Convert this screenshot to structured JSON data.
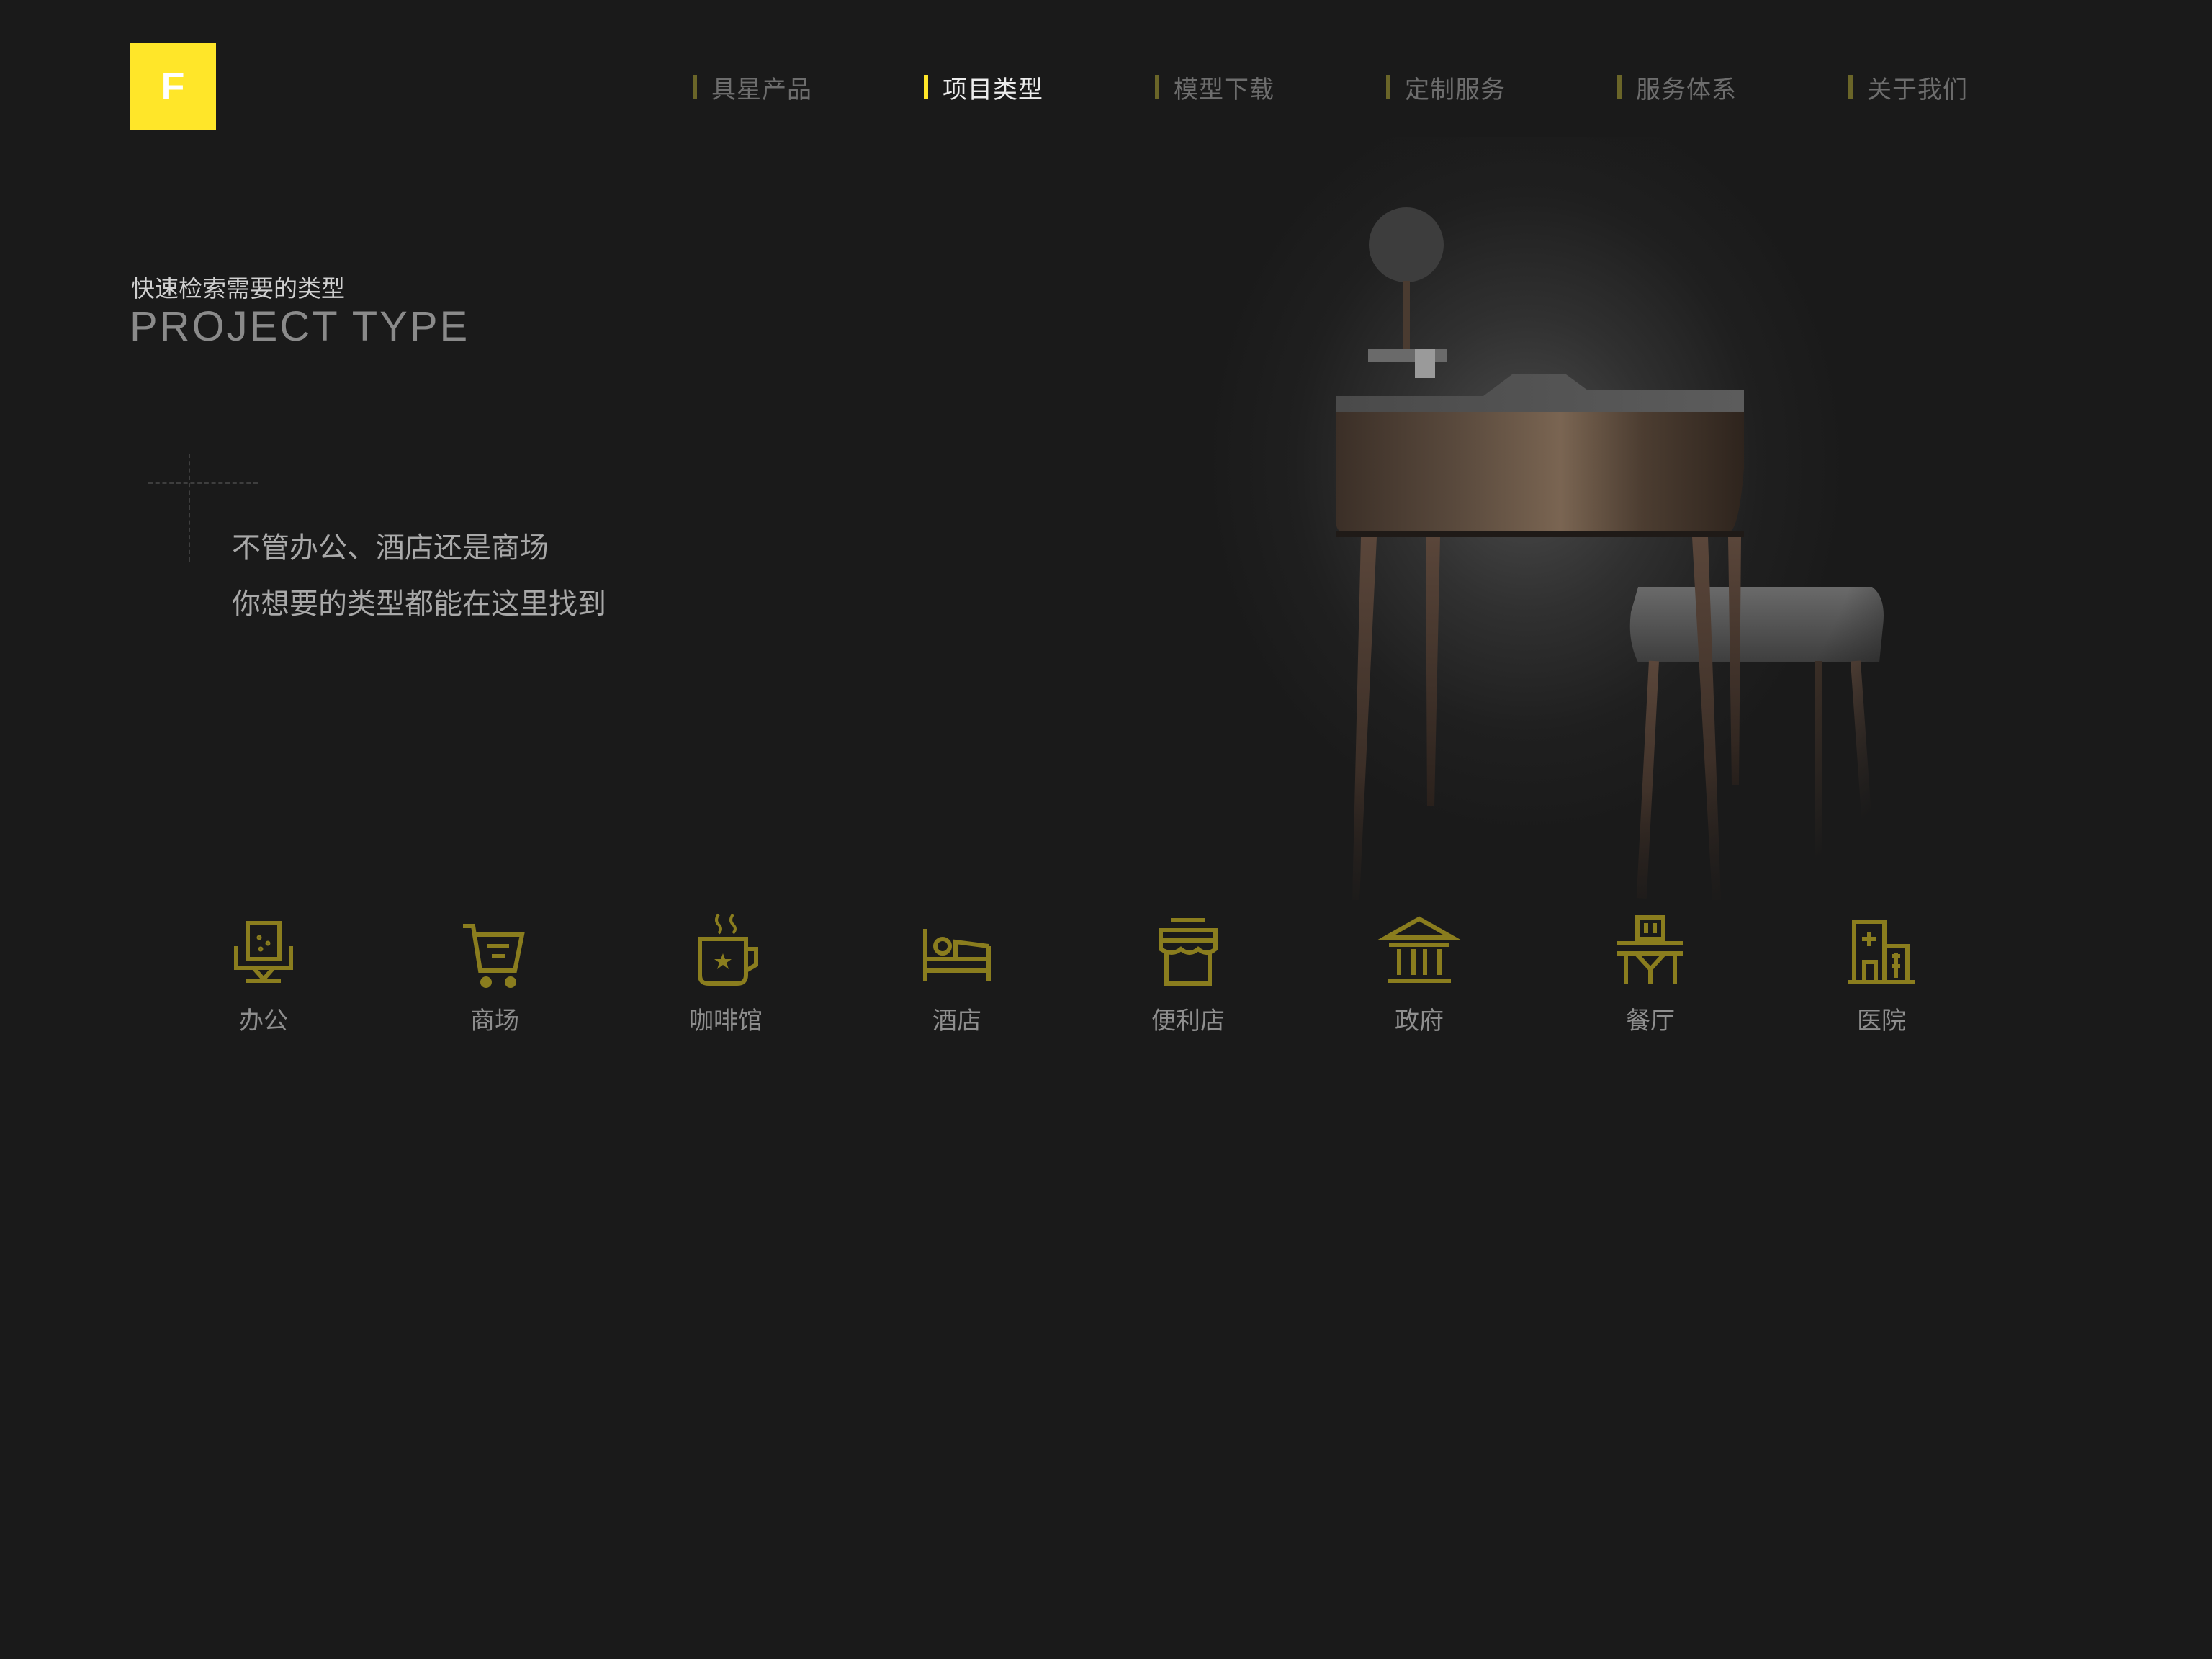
{
  "brand": {
    "logo_text": "F",
    "accent_color": "#ffe629",
    "icon_color": "#8a7d1e",
    "background_color": "#1a1a1a"
  },
  "nav": {
    "items": [
      {
        "label": "具星产品",
        "active": false
      },
      {
        "label": "项目类型",
        "active": true
      },
      {
        "label": "模型下载",
        "active": false
      },
      {
        "label": "定制服务",
        "active": false
      },
      {
        "label": "服务体系",
        "active": false
      },
      {
        "label": "关于我们",
        "active": false
      }
    ]
  },
  "hero": {
    "subtitle": "快速检索需要的类型",
    "title": "PROJECT TYPE",
    "desc_line1": "不管办公、酒店还是商场",
    "desc_line2": "你想要的类型都能在这里找到",
    "image": "desk-and-stool-photo"
  },
  "categories": [
    {
      "label": "办公",
      "icon": "office-chair-icon"
    },
    {
      "label": "商场",
      "icon": "shopping-cart-icon"
    },
    {
      "label": "咖啡馆",
      "icon": "coffee-cup-icon"
    },
    {
      "label": "酒店",
      "icon": "hotel-bed-icon"
    },
    {
      "label": "便利店",
      "icon": "storefront-icon"
    },
    {
      "label": "政府",
      "icon": "government-building-icon"
    },
    {
      "label": "餐厅",
      "icon": "restaurant-table-icon"
    },
    {
      "label": "医院",
      "icon": "hospital-icon"
    }
  ]
}
